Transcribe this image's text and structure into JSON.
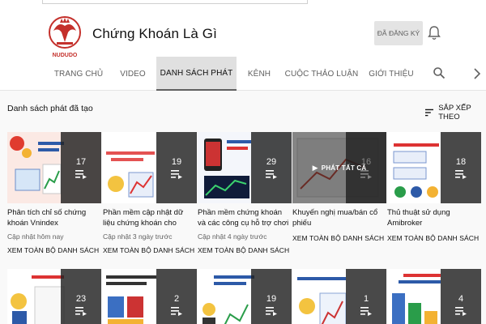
{
  "channel": {
    "name": "Chứng Khoán Là Gì",
    "logo_text": "NUDUDO",
    "subscribe_label": "ĐÃ ĐĂNG KÝ"
  },
  "tabs": [
    {
      "label": "TRANG CHỦ"
    },
    {
      "label": "VIDEO"
    },
    {
      "label": "DANH SÁCH PHÁT"
    },
    {
      "label": "KÊNH"
    },
    {
      "label": "CUỘC THẢO LUẬN"
    },
    {
      "label": "GIỚI THIỆU"
    }
  ],
  "active_tab": "DANH SÁCH PHÁT",
  "section": {
    "title": "Danh sách phát đã tạo",
    "sort_label": "SẮP XẾP THEO"
  },
  "playlists": [
    {
      "count": "17",
      "title": "Phân tích chỉ số chứng khoán Vnindex",
      "updated": "Cập nhật hôm nay",
      "link": "XEM TOÀN BỘ DANH SÁCH"
    },
    {
      "count": "19",
      "title": "Phần mềm cập nhật dữ liệu chứng khoán cho Amibroker và...",
      "updated": "Cập nhật 3 ngày trước",
      "link": "XEM TOÀN BỘ DANH SÁCH"
    },
    {
      "count": "29",
      "title": "Phần mềm chứng khoán và các công cụ hỗ trợ chơi chứng khoán",
      "updated": "Cập nhật 4 ngày trước",
      "link": "XEM TOÀN BỘ DANH SÁCH"
    },
    {
      "count": "16",
      "title": "Khuyến nghị mua/bán cổ phiếu",
      "updated": "",
      "link": "XEM TOÀN BỘ DANH SÁCH",
      "hover_label": "PHÁT TẤT CẢ"
    },
    {
      "count": "18",
      "title": "Thủ thuật sử dụng Amibroker",
      "updated": "",
      "link": "XEM TOÀN BỘ DANH SÁCH"
    },
    {
      "count": "23"
    },
    {
      "count": "2"
    },
    {
      "count": "19"
    },
    {
      "count": "1"
    },
    {
      "count": "4"
    }
  ],
  "colors": {
    "background": "#f9f9f9",
    "overlay": "#212121",
    "brand_red": "#c4302b"
  }
}
